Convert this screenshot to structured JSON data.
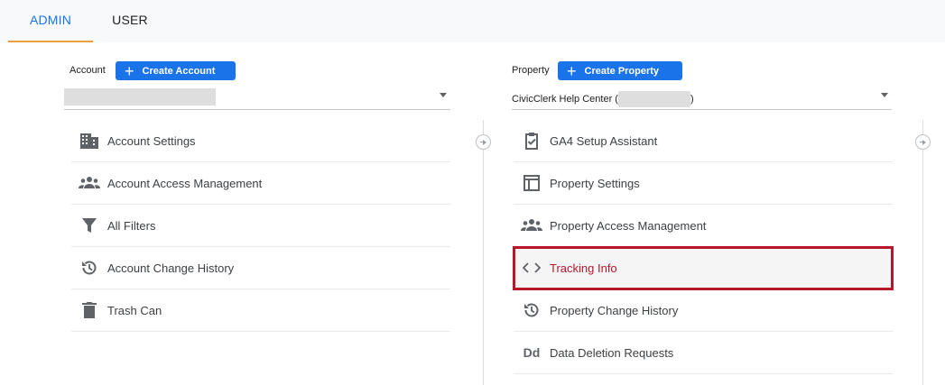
{
  "tabs": [
    {
      "label": "ADMIN"
    },
    {
      "label": "USER"
    }
  ],
  "account": {
    "label": "Account",
    "create_label": "Create Account",
    "items": [
      {
        "label": "Account Settings",
        "icon": "building-icon"
      },
      {
        "label": "Account Access Management",
        "icon": "people-icon"
      },
      {
        "label": "All Filters",
        "icon": "filter-icon"
      },
      {
        "label": "Account Change History",
        "icon": "history-icon"
      },
      {
        "label": "Trash Can",
        "icon": "trash-icon"
      }
    ]
  },
  "property": {
    "label": "Property",
    "create_label": "Create Property",
    "selected_prefix": "CivicClerk Help Center (",
    "selected_suffix": ")",
    "items": [
      {
        "label": "GA4 Setup Assistant",
        "icon": "clipboard-check-icon"
      },
      {
        "label": "Property Settings",
        "icon": "layout-icon"
      },
      {
        "label": "Property Access Management",
        "icon": "people-icon"
      },
      {
        "label": "Tracking Info",
        "icon": "code-icon",
        "highlighted": true
      },
      {
        "label": "Property Change History",
        "icon": "history-icon"
      },
      {
        "label": "Data Deletion Requests",
        "icon": "dd-icon",
        "icon_text": "Dd"
      }
    ]
  },
  "colors": {
    "accent": "#1a73e8",
    "tab_underline": "#e8a33c",
    "highlight": "#b5172b"
  }
}
